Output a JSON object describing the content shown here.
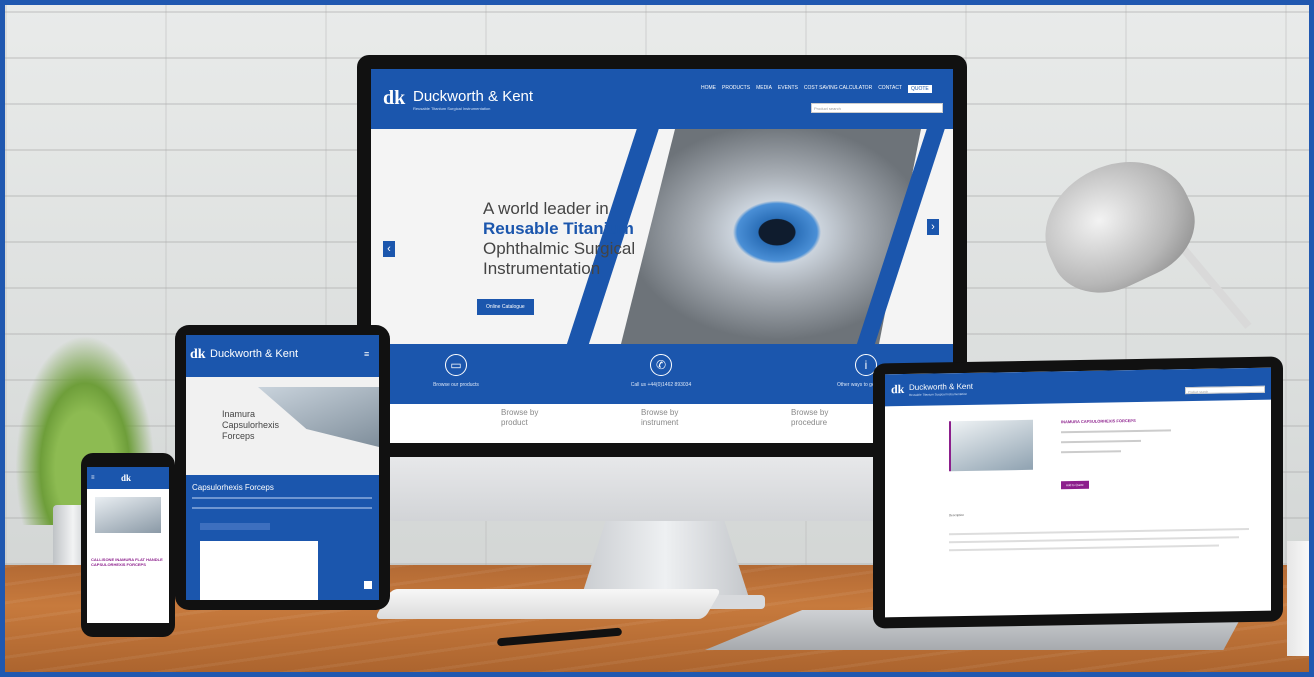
{
  "brand": {
    "logo_mark": "dk",
    "name": "Duckworth & Kent",
    "tagline": "Reusable Titanium Surgical Instrumentation"
  },
  "nav": {
    "items": [
      "HOME",
      "PRODUCTS",
      "MEDIA",
      "EVENTS",
      "COST SAVING CALCULATOR",
      "CONTACT"
    ],
    "quote": "QUOTE",
    "search_placeholder": "Product search"
  },
  "hero": {
    "line1": "A world leader in",
    "line2": "Reusable Titanium",
    "line3": "Ophthalmic Surgical",
    "line4": "Instrumentation",
    "cta": "Online Catalogue"
  },
  "features": [
    {
      "icon": "laptop-icon",
      "label": "Browse our products"
    },
    {
      "icon": "phone-icon",
      "label": "Call us +44(0)1462 893034"
    },
    {
      "icon": "info-icon",
      "label": "Other ways to get in touch"
    }
  ],
  "browse": {
    "product": "Browse by product",
    "instrument": "Browse by instrument",
    "procedure": "Browse by procedure"
  },
  "tablet": {
    "hero_title_1": "Inamura",
    "hero_title_2": "Capsulorhexis",
    "hero_title_3": "Forceps",
    "section_title": "Capsulorhexis Forceps"
  },
  "phone": {
    "product_heading": "CALLISONE INAMURA FLAT HANDLE CAPSULORHEXIS FORCEPS"
  },
  "laptop": {
    "product_heading": "INAMURA CAPSULORHEXIS FORCEPS",
    "button": "Add to Quote",
    "description_label": "Description"
  },
  "colors": {
    "brand_blue": "#1b56ad",
    "accent_purple": "#8c1f8c",
    "frame_border": "#2058b0"
  }
}
